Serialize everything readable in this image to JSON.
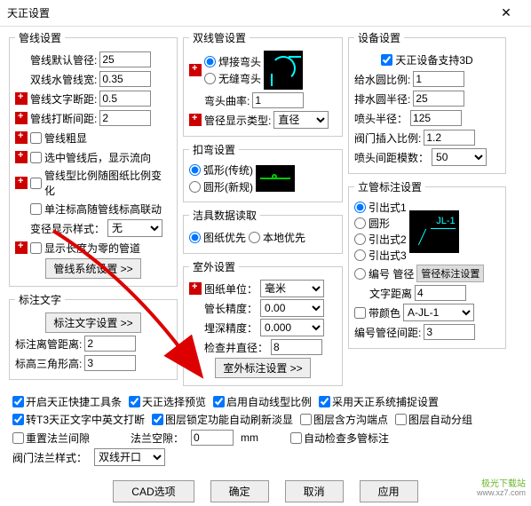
{
  "title": "天正设置",
  "col1": {
    "group1_title": "管线设置",
    "default_dia_lbl": "管线默认管径:",
    "default_dia": "25",
    "dbl_water_lbl": "双线水管线宽:",
    "dbl_water": "0.35",
    "text_break_lbl": "管线文字断距:",
    "text_break": "0.5",
    "break_gap_lbl": "管线打断间距:",
    "break_gap": "2",
    "coarse_lbl": "管线粗显",
    "show_flow_lbl": "选中管线后，显示流向",
    "ratio_change_lbl": "管线型比例随图纸比例变化",
    "single_link_lbl": "单注标高随管线标高联动",
    "dia_style_lbl": "变径显示样式：",
    "dia_style": "无",
    "zero_len_lbl": "显示长度为零的管道",
    "sys_btn": "管线系统设置 >>",
    "group2_title": "标注文字",
    "text_btn": "标注文字设置 >>",
    "to_pipe_lbl": "标注离管距离:",
    "to_pipe": "2",
    "tri_h_lbl": "标高三角形高:",
    "tri_h": "3"
  },
  "col2": {
    "group1_title": "双线管设置",
    "weld_lbl": "焊接弯头",
    "seamless_lbl": "无缝弯头",
    "curve_lbl": "弯头曲率:",
    "curve": "1",
    "dia_disp_lbl": "管径显示类型:",
    "dia_disp": "直径",
    "group2_title": "扣弯设置",
    "arc_lbl": "弧形(传统)",
    "circle_lbl": "圆形(新规)",
    "group3_title": "洁具数据读取",
    "draw_first_lbl": "图纸优先",
    "local_first_lbl": "本地优先",
    "group4_title": "室外设置",
    "unit_lbl": "图纸单位：",
    "unit": "毫米",
    "len_prec_lbl": "管长精度：",
    "len_prec": "0.00",
    "depth_prec_lbl": "埋深精度：",
    "depth_prec": "0.000",
    "well_dia_lbl": "检查井直径：",
    "well_dia": "8",
    "outdoor_btn": "室外标注设置 >>"
  },
  "col3": {
    "group1_title": "设备设置",
    "support3d_lbl": "天正设备支持3D",
    "water_ratio_lbl": "给水圆比例:",
    "water_ratio": "1",
    "drain_r_lbl": "排水圆半径:",
    "drain_r": "25",
    "spray_r_lbl": "喷头半径：",
    "spray_r": "125",
    "valve_ratio_lbl": "阀门插入比例:",
    "valve_ratio": "1.2",
    "spray_mod_lbl": "喷头间距模数：",
    "spray_mod": "50",
    "group2_title": "立管标注设置",
    "lead1_lbl": "引出式1",
    "circ_lbl": "圆形",
    "lead2_lbl": "引出式2",
    "lead3_lbl": "引出式3",
    "num_pipe_lbl": "编号 管径",
    "dia_label_btn": "管径标注设置",
    "text_dist_lbl": "文字距离",
    "text_dist": "4",
    "color_tag_lbl": "带颜色",
    "color_tag": "A-JL-1",
    "num_dia_gap_lbl": "编号管径间距:",
    "num_dia_gap": "3"
  },
  "bottom": {
    "quick_tool_lbl": "开启天正快捷工具条",
    "sel_preview_lbl": "天正选择预览",
    "auto_linescale_lbl": "启用自动线型比例",
    "sys_snap_lbl": "采用天正系统捕捉设置",
    "t3_break_lbl": "转T3天正文字中英文打断",
    "layer_lock_lbl": "图层锁定功能自动刷新淡显",
    "layer_endpt_lbl": "图层含方沟端点",
    "layer_autogrp_lbl": "图层自动分组",
    "reset_flange_lbl": "重置法兰间隙",
    "flange_gap_lbl": "法兰空隙：",
    "flange_gap": "0",
    "mm": "mm",
    "auto_check_lbl": "自动检查多管标注",
    "valve_flange_style_lbl": "阀门法兰样式：",
    "valve_flange_style": "双线开口"
  },
  "footer": {
    "cad_opt": "CAD选项",
    "ok": "确定",
    "cancel": "取消",
    "apply": "应用"
  },
  "watermark": {
    "name": "极光下载站",
    "url": "www.xz7.com"
  }
}
